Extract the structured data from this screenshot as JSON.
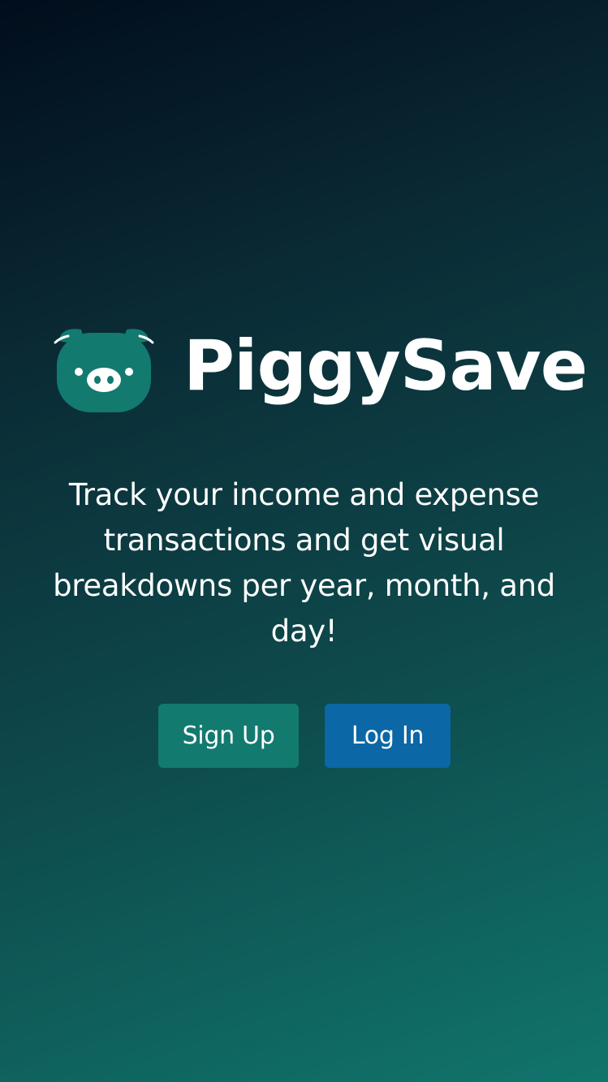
{
  "app": {
    "name": "PiggySave",
    "logo_icon": "pig-face-icon",
    "logo_color": "#137a70"
  },
  "hero": {
    "tagline": "Track your income and expense transactions and get visual breakdowns per year, month, and day!"
  },
  "actions": {
    "signup_label": "Sign Up",
    "login_label": "Log In"
  },
  "colors": {
    "background_start": "#010d1c",
    "background_end": "#10756c",
    "signup_button": "#137a70",
    "login_button": "#0b67a5",
    "text": "#ffffff"
  }
}
